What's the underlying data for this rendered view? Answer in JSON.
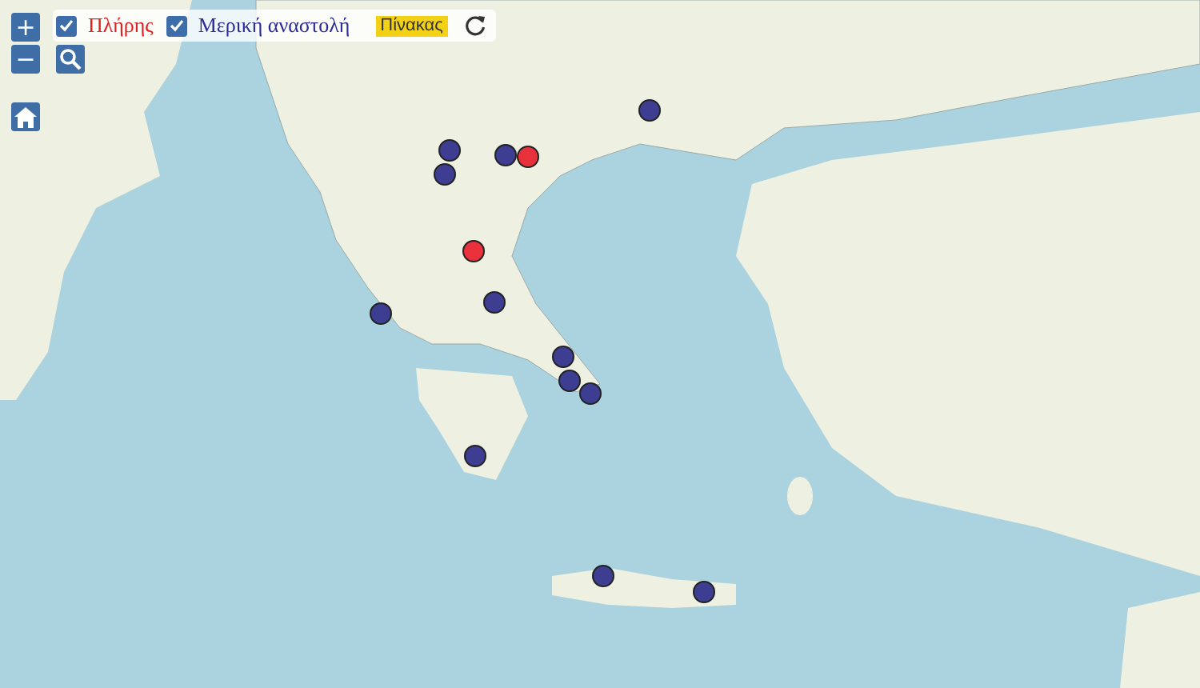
{
  "map_controls": {
    "zoom_in": "+",
    "zoom_out": "−"
  },
  "filters": [
    {
      "label": "Πλήρης",
      "checked": true,
      "color": "#e02020"
    },
    {
      "label": "Μερική αναστολή",
      "checked": true,
      "color": "#2a2a9a"
    }
  ],
  "table_button": "Πίνακας",
  "markers": [
    {
      "color": "#3d3d92"
    },
    {
      "color": "#3d3d92"
    },
    {
      "color": "#3d3d92"
    },
    {
      "color": "#3d3d92"
    },
    {
      "color": "#e8313a"
    },
    {
      "color": "#e8313a"
    },
    {
      "color": "#3d3d92"
    },
    {
      "color": "#3d3d92"
    },
    {
      "color": "#3d3d92"
    },
    {
      "color": "#3d3d92"
    },
    {
      "color": "#3d3d92"
    },
    {
      "color": "#3d3d92"
    },
    {
      "color": "#3d3d92"
    },
    {
      "color": "#3d3d92"
    }
  ]
}
